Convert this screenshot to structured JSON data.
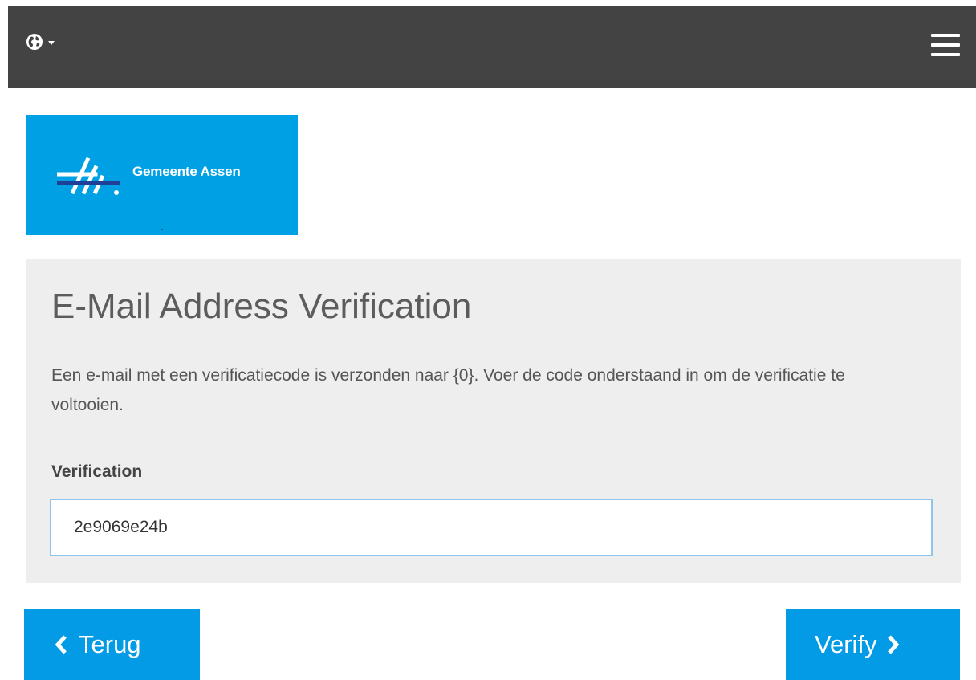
{
  "navbar": {
    "language_icon": "globe-icon",
    "language_caret_icon": "caret-down-icon",
    "menu_icon": "hamburger-menu-icon",
    "background_color": "#434343"
  },
  "logo": {
    "text": "Gemeente Assen",
    "background_color": "#00a0e4"
  },
  "form": {
    "title": "E-Mail Address Verification",
    "intro": "Een e-mail met een verificatiecode is verzonden naar {0}. Voer de code onderstaand in om de verificatie te voltooien.",
    "field_label": "Verification",
    "field_value": "2e9069e24b"
  },
  "actions": {
    "back_label": "Terug",
    "back_icon": "chevron-left-icon",
    "verify_label": "Verify",
    "verify_icon": "chevron-right-icon",
    "button_color": "#039be5"
  }
}
